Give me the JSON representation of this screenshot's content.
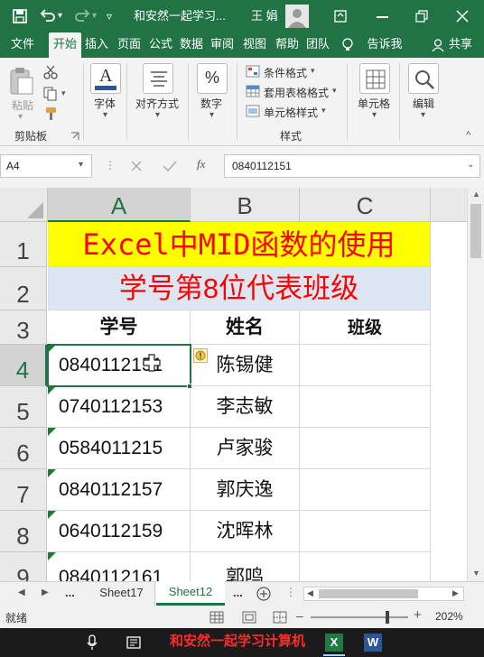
{
  "title_bar": {
    "doc_title": "和安然一起学习...",
    "user_name": "王 娟",
    "colors": {
      "brand": "#217346"
    }
  },
  "tabs": [
    {
      "label": "文件"
    },
    {
      "label": "开始"
    },
    {
      "label": "插入"
    },
    {
      "label": "页面"
    },
    {
      "label": "公式"
    },
    {
      "label": "数据"
    },
    {
      "label": "审阅"
    },
    {
      "label": "视图"
    },
    {
      "label": "帮助"
    },
    {
      "label": "团队"
    },
    {
      "label": "告诉我"
    },
    {
      "label": "共享"
    }
  ],
  "active_tab": "开始",
  "ribbon": {
    "paste_label": "粘贴",
    "clipboard_group": "剪贴板",
    "font_label": "字体",
    "align_label": "对齐方式",
    "number_label": "数字",
    "number_icon_text": "%",
    "cond_format": "条件格式",
    "table_format": "套用表格格式",
    "cell_style": "单元格样式",
    "styles_group": "样式",
    "cells_label": "单元格",
    "edit_label": "编辑"
  },
  "formula_bar": {
    "name_box": "A4",
    "fx_label": "fx",
    "value": "0840112151"
  },
  "columns": [
    "A",
    "B",
    "C"
  ],
  "rows": [
    "1",
    "2",
    "3",
    "4",
    "5",
    "6",
    "7",
    "8",
    "9"
  ],
  "sheet": {
    "title_banner": "Excel中MID函数的使用",
    "subtitle_banner": "学号第8位代表班级",
    "headers": {
      "student_id": "学号",
      "name": "姓名",
      "class": "班级"
    },
    "records": [
      {
        "id": "0840112151",
        "name": "陈锡健"
      },
      {
        "id": "0740112153",
        "name": "李志敏"
      },
      {
        "id": "0584011215",
        "name": "卢家骏"
      },
      {
        "id": "0840112157",
        "name": "郭庆逸"
      },
      {
        "id": "0640112159",
        "name": "沈晖林"
      },
      {
        "id": "0840112161",
        "name": "郭鸣"
      }
    ],
    "banner_colors": {
      "title_bg": "#ffff00",
      "title_fg": "#ff0000",
      "subtitle_bg": "#dce6f2",
      "subtitle_fg": "#ff0000"
    }
  },
  "sheet_tabs": {
    "ellipsis": "...",
    "tabs": [
      "Sheet17",
      "Sheet12"
    ],
    "active": "Sheet12"
  },
  "status": {
    "ready": "就绪",
    "zoom": "202%"
  },
  "taskbar": {
    "caption": "和安然一起学习计算机"
  }
}
